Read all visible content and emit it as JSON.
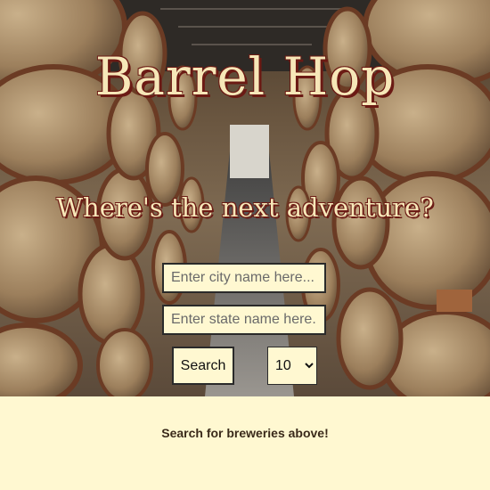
{
  "header": {
    "title": "Barrel Hop",
    "tagline": "Where's the next adventure?"
  },
  "search": {
    "city_placeholder": "Enter city name here...",
    "city_value": "",
    "state_placeholder": "Enter state name here...",
    "state_value": "",
    "button_label": "Search",
    "count_selected": "10"
  },
  "results": {
    "message": "Search for breweries above!"
  },
  "colors": {
    "page_background": "#fff8d1",
    "title_text": "#f6e7b8",
    "title_outline": "#6b1a14",
    "field_border": "#2a2a2a"
  }
}
